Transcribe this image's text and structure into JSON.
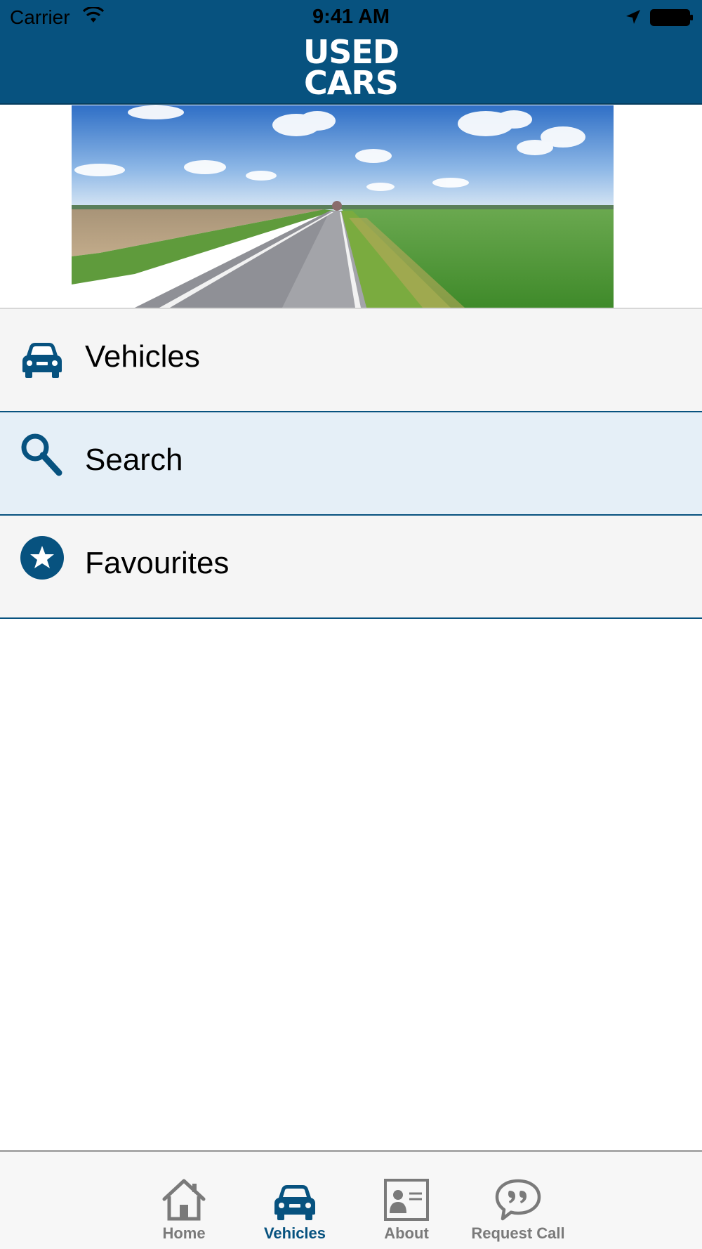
{
  "status_bar": {
    "carrier": "Carrier",
    "time": "9:41 AM"
  },
  "header": {
    "logo_line1": "USED",
    "logo_line2": "CARS",
    "color": "#07527f"
  },
  "menu": {
    "items": [
      {
        "label": "Vehicles",
        "icon": "car-icon",
        "selected": false
      },
      {
        "label": "Search",
        "icon": "magnifier-icon",
        "selected": true
      },
      {
        "label": "Favourites",
        "icon": "star-icon",
        "selected": false
      }
    ]
  },
  "tabbar": {
    "tabs": [
      {
        "label": "Home",
        "icon": "home-icon",
        "active": false
      },
      {
        "label": "Vehicles",
        "icon": "car-icon",
        "active": true
      },
      {
        "label": "About",
        "icon": "contact-card-icon",
        "active": false
      },
      {
        "label": "Request Call",
        "icon": "speech-bubble-icon",
        "active": false
      }
    ]
  },
  "colors": {
    "brand": "#07527f",
    "selected_row": "#e5eff7",
    "row": "#f5f5f5",
    "tab_inactive": "#7a7a7a"
  }
}
